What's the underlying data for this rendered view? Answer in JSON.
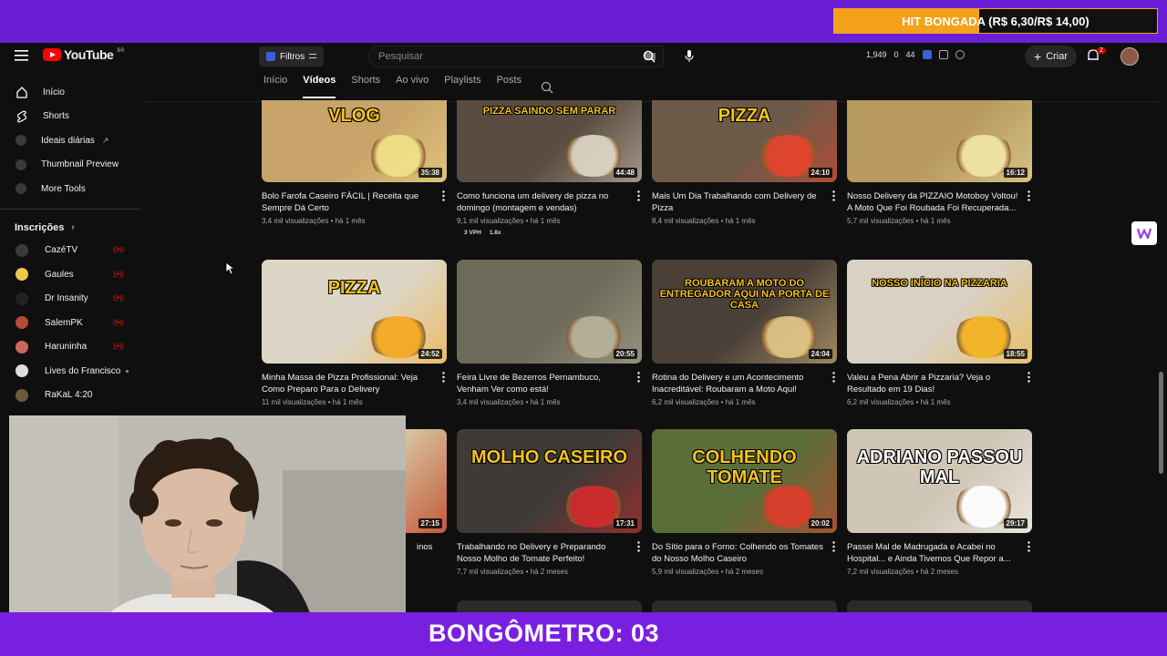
{
  "stream": {
    "hit_label": "HIT BONGADA (R$ 6,30/R$ 14,00)",
    "hit_progress": 0.45,
    "bongometro": "BONGÔMETRO: 03"
  },
  "header": {
    "logo_text": "YouTube",
    "logo_country": "BR",
    "filter_label": "Filtros",
    "search_placeholder": "Pesquisar",
    "stats": [
      "1,949",
      "0",
      "44"
    ],
    "create_label": "Criar",
    "notifications": "2"
  },
  "tabs": [
    {
      "label": "Início"
    },
    {
      "label": "Vídeos",
      "active": true
    },
    {
      "label": "Shorts"
    },
    {
      "label": "Ao vivo"
    },
    {
      "label": "Playlists"
    },
    {
      "label": "Posts"
    }
  ],
  "sidebar": {
    "items": [
      {
        "label": "Início",
        "icon": "home-icon"
      },
      {
        "label": "Shorts",
        "icon": "shorts-icon"
      },
      {
        "label": "Ideais diárias",
        "icon": "app-icon",
        "external": true
      },
      {
        "label": "Thumbnail Preview",
        "icon": "app-icon"
      },
      {
        "label": "More Tools",
        "icon": "app-icon"
      }
    ],
    "subscriptions_heading": "Inscrições",
    "subscriptions": [
      {
        "name": "CazéTV",
        "color": "#3a3a3a",
        "live": true
      },
      {
        "name": "Gaules",
        "color": "#e9c84a",
        "live": true
      },
      {
        "name": "Dr Insanity",
        "color": "#222222",
        "live": true
      },
      {
        "name": "SalemPK",
        "color": "#b44a3a",
        "live": true
      },
      {
        "name": "Haruninha",
        "color": "#c9685a",
        "live": true
      },
      {
        "name": "Lives do Francisco",
        "color": "#dddddd",
        "dot": true
      },
      {
        "name": "RaKaL 4:20",
        "color": "#6a5a3a"
      }
    ]
  },
  "videos": [
    {
      "title": "Bolo Farofa Caseiro FÁCIL | Receita que Sempre Dá Certo",
      "views": "3,4 mil visualizações • há 1 mês",
      "duration": "35:38",
      "thumb_text": "VLOG",
      "bg": "#c7a269",
      "accent": "#f2e28a"
    },
    {
      "title": "Como funciona um delivery de pizza no domingo (montagem e vendas)",
      "views": "9,1 mil visualizações • há 1 mês",
      "extra": "3 VPH     1.8x",
      "duration": "44:48",
      "thumb_text": "PIZZA SAINDO SEM PARAR",
      "bg": "#5a4c40",
      "accent": "#e0d9c8"
    },
    {
      "title": "Mais Um Dia Trabalhando com Delivery de Pizza",
      "views": "8,4 mil visualizações • há 1 mês",
      "duration": "24:10",
      "thumb_text": "PIZZA",
      "bg": "#6b5a48",
      "accent": "#e8432b"
    },
    {
      "title": "Nosso Delivery da PIZZAIO Motoboy Voltou! A Moto Que Foi Roubada Foi Recuperada...",
      "views": "5,7 mil visualizações • há 1 mês",
      "duration": "16:12",
      "thumb_text": "",
      "bg": "#b89a5e",
      "accent": "#f0e6a8"
    },
    {
      "title": "Minha Massa de Pizza Profissional: Veja Como Preparo Para o Delivery",
      "views": "11 mil visualizações • há 1 mês",
      "duration": "24:52",
      "thumb_text": "PIZZA",
      "bg": "#ddd6c6",
      "accent": "#f4a81c"
    },
    {
      "title": "Feira Livre de Bezerros Pernambuco, Venham Ver como está!",
      "views": "3,4 mil visualizações • há 1 mês",
      "duration": "20:55",
      "thumb_text": "",
      "bg": "#6d6a5a",
      "accent": "#b8b49c"
    },
    {
      "title": "Rotina do Delivery e um Acontecimento Inacreditável: Roubaram a Moto Aqui!",
      "views": "6,2 mil visualizações • há 1 mês",
      "duration": "24:04",
      "thumb_text": "ROUBARAM A MOTO DO ENTREGADOR AQUI NA PORTA DE CASA",
      "bg": "#4a4038",
      "accent": "#e7c887"
    },
    {
      "title": "Valeu a Pena Abrir a Pizzaria? Veja o Resultado em 19 Dias!",
      "views": "6,2 mil visualizações • há 1 mês",
      "duration": "18:55",
      "thumb_text": "NOSSO INÍCIO NA PIZZARIA",
      "bg": "#d9d1c4",
      "accent": "#f4b21c"
    },
    {
      "title": "Trabalhando no Delivery e Preparando Nosso Molho de Tomate Perfeito!",
      "views": "7,7 mil visualizações • há 2 meses",
      "duration": "17:31",
      "thumb_text": "MOLHO CASEIRO",
      "bg": "#3e3a36",
      "accent": "#d42a2a"
    },
    {
      "title": "Do Sítio para o Forno: Colhendo os Tomates do Nosso Molho Caseiro",
      "views": "5,9 mil visualizações • há 2 meses",
      "duration": "20:02",
      "thumb_text": "COLHENDO TOMATE",
      "bg": "#5a6e3a",
      "accent": "#e03b2b"
    },
    {
      "title": "Passei Mal de Madrugada e Acabei no Hospital... e Ainda Tivemos Que Repor a...",
      "views": "7,2 mil visualizações • há 2 meses",
      "duration": "29:17",
      "thumb_text": "ADRIANO PASSOU MAL",
      "bg": "#cfc6b6",
      "accent": "#ffffff"
    }
  ],
  "hidden_card": {
    "duration": "27:15",
    "title_fragment": "inos"
  }
}
